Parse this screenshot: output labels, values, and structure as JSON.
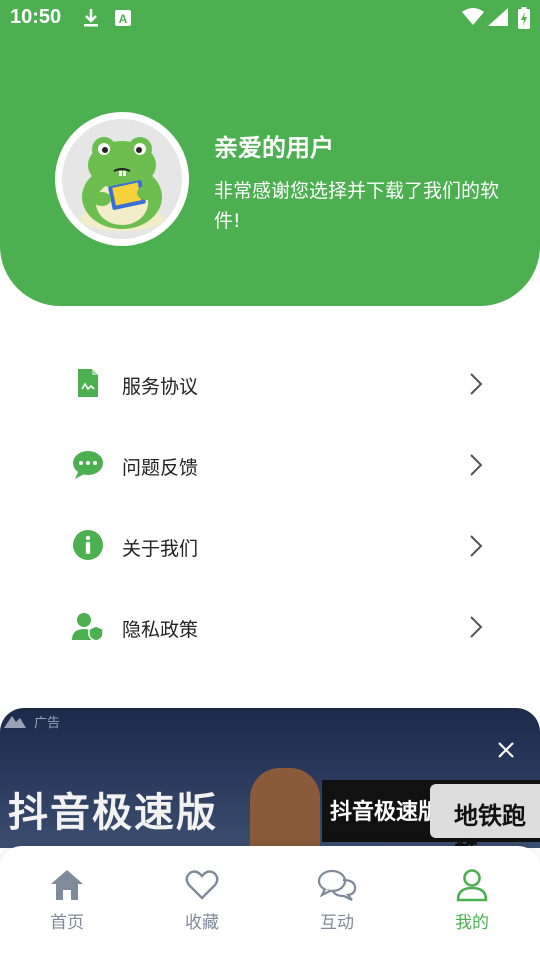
{
  "status_bar": {
    "time": "10:50"
  },
  "profile": {
    "greeting_title": "亲爱的用户",
    "greeting_message": "非常感谢您选择并下载了我们的软件!"
  },
  "menu": {
    "items": [
      {
        "label": "服务协议",
        "icon": "document-icon"
      },
      {
        "label": "问题反馈",
        "icon": "chat-bubble-icon"
      },
      {
        "label": "关于我们",
        "icon": "info-icon"
      },
      {
        "label": "隐私政策",
        "icon": "user-shield-icon"
      }
    ]
  },
  "ad": {
    "tag": "广告",
    "headline": "抖音极速版",
    "search_query": "抖音极速版搜索",
    "search_button": "地铁跑酷"
  },
  "tabbar": {
    "tabs": [
      {
        "label": "首页",
        "icon": "home-icon"
      },
      {
        "label": "收藏",
        "icon": "heart-icon"
      },
      {
        "label": "互动",
        "icon": "chat-icon"
      },
      {
        "label": "我的",
        "icon": "user-icon",
        "active": true
      }
    ]
  },
  "colors": {
    "accent": "#4caf50",
    "tab_inactive": "#7f8a9a"
  }
}
